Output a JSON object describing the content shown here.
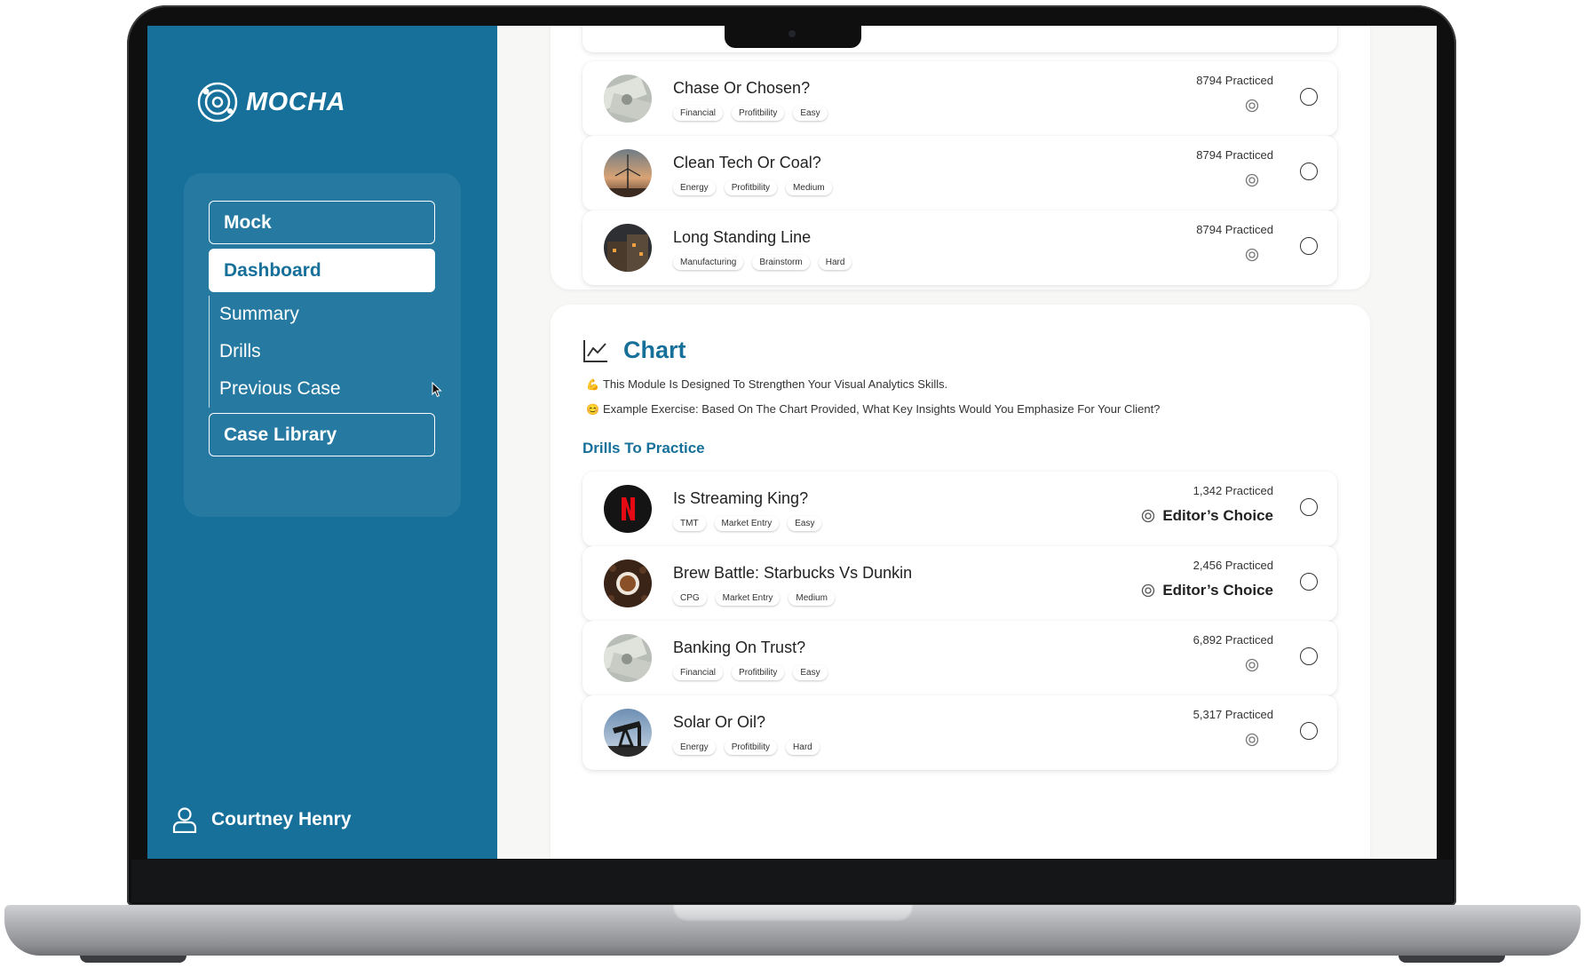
{
  "app": {
    "brand": "MOCHA",
    "accent_color": "#16709a"
  },
  "sidebar": {
    "nav": {
      "mock": "Mock",
      "dashboard": "Dashboard",
      "sub_items": [
        "Summary",
        "Drills",
        "Previous Case"
      ],
      "case_library": "Case Library"
    },
    "user": {
      "name": "Courtney Henry",
      "icon": "user-icon"
    }
  },
  "previous_section": {
    "drills": [
      {
        "title": "Chase Or Chosen?",
        "tags": [
          "Financial",
          "Profitbility",
          "Easy"
        ],
        "practiced": "8794 Practiced",
        "thumb": "money-image"
      },
      {
        "title": "Clean Tech Or Coal?",
        "tags": [
          "Energy",
          "Profitbility",
          "Medium"
        ],
        "practiced": "8794 Practiced",
        "thumb": "windmill-image"
      },
      {
        "title": "Long Standing Line",
        "tags": [
          "Manufacturing",
          "Brainstorm",
          "Hard"
        ],
        "practiced": "8794 Practiced",
        "thumb": "factory-image"
      }
    ]
  },
  "chart_section": {
    "title": "Chart",
    "icon": "line-chart-icon",
    "description_1": "This Module Is Designed To Strengthen Your Visual Analytics Skills.",
    "description_2": "Example Exercise: Based On The Chart Provided, What Key Insights Would You Emphasize For Your Client?",
    "emoji_1": "💪",
    "emoji_2": "😊",
    "drills_heading": "Drills To Practice",
    "drills": [
      {
        "title": "Is Streaming King?",
        "tags": [
          "TMT",
          "Market Entry",
          "Easy"
        ],
        "practiced": "1,342 Practiced",
        "badge": "Editor’s Choice",
        "thumb": "netflix-logo"
      },
      {
        "title": "Brew Battle: Starbucks Vs Dunkin",
        "tags": [
          "CPG",
          "Market Entry",
          "Medium"
        ],
        "practiced": "2,456 Practiced",
        "badge": "Editor’s Choice",
        "thumb": "coffee-image"
      },
      {
        "title": "Banking On Trust?",
        "tags": [
          "Financial",
          "Profitbility",
          "Easy"
        ],
        "practiced": "6,892 Practiced",
        "thumb": "money-image"
      },
      {
        "title": "Solar Or Oil?",
        "tags": [
          "Energy",
          "Profitbility",
          "Hard"
        ],
        "practiced": "5,317 Practiced",
        "thumb": "oil-pump-image"
      }
    ]
  }
}
